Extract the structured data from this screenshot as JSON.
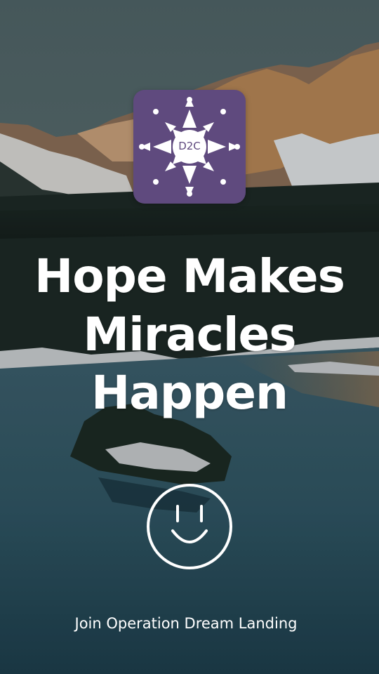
{
  "logo": {
    "text": "D2C",
    "background": "#5f4a7e"
  },
  "headline": {
    "line1": "Hope Makes",
    "line2": "Miracles",
    "line3": "Happen"
  },
  "cta": {
    "text": "Join Operation Dream Landing"
  },
  "icons": {
    "logo_sun": "sun-icon",
    "smiley": "smiley-face-icon"
  },
  "background": {
    "description_color_sky": "#4c6265",
    "description_color_lake": "#2b4e5a"
  }
}
